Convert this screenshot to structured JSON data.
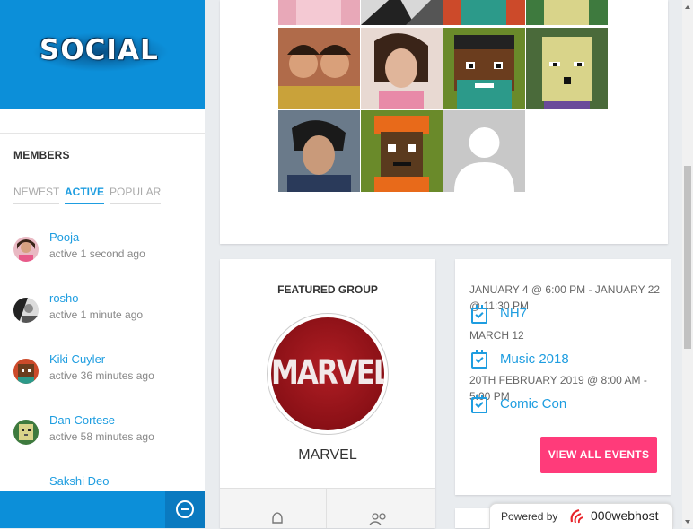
{
  "sidebar": {
    "logo_text": "SOCIAL",
    "members_title": "MEMBERS",
    "tabs": [
      {
        "label": "NEWEST",
        "active": false
      },
      {
        "label": "ACTIVE",
        "active": true
      },
      {
        "label": "POPULAR",
        "active": false
      }
    ],
    "members": [
      {
        "name": "Pooja",
        "activity": "active 1 second ago"
      },
      {
        "name": "rosho",
        "activity": "active 1 minute ago"
      },
      {
        "name": "Kiki Cuyler",
        "activity": "active 36 minutes ago"
      },
      {
        "name": "Dan Cortese",
        "activity": "active 58 minutes ago"
      },
      {
        "name": "Sakshi Deo",
        "activity": ""
      }
    ]
  },
  "featured_group": {
    "heading": "FEATURED GROUP",
    "logo_text": "MARVEL",
    "name": "MARVEL"
  },
  "events": {
    "items": [
      {
        "date": "JANUARY 4 @ 6:00 PM - JANUARY 22 @ 11:30 PM",
        "title": "NH7"
      },
      {
        "date": "MARCH 12",
        "title": "Music 2018"
      },
      {
        "date": "20TH FEBRUARY 2019 @ 8:00 AM - 5:00 PM",
        "title": "Comic Con"
      }
    ],
    "view_all_label": "VIEW ALL EVENTS"
  },
  "footer_badge": {
    "powered_by": "Powered by",
    "brand": "000webhost"
  },
  "colors": {
    "brand_blue": "#0c8fd9",
    "link_blue": "#1e9de0",
    "accent_pink": "#ff3b7a"
  }
}
